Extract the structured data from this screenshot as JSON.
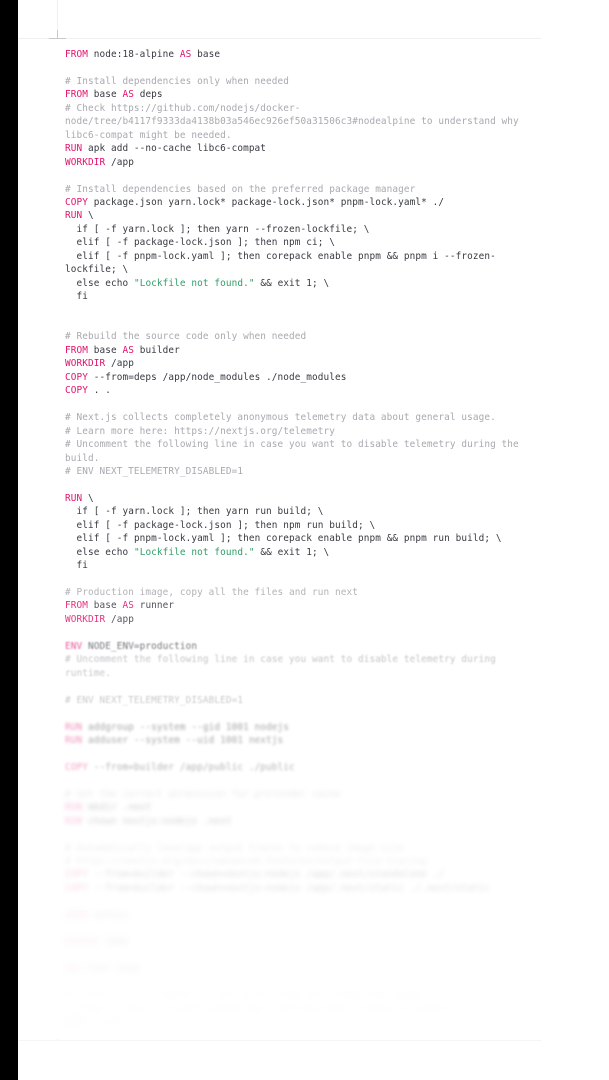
{
  "document": {
    "language": "dockerfile",
    "colors": {
      "keyword": "#e3116c",
      "plain": "#383a42",
      "comment": "#a9a9b0",
      "string": "#2f9e68",
      "background": "#ffffff",
      "guide_line": "#f0f0f2",
      "edge_strip": "#000000"
    }
  },
  "code": {
    "groups": [
      {
        "blur": 0,
        "lines": [
          [
            {
              "t": "kw",
              "v": "FROM"
            },
            {
              "t": "plain",
              "v": " node:18-alpine "
            },
            {
              "t": "kw",
              "v": "AS"
            },
            {
              "t": "plain",
              "v": " base"
            }
          ],
          [],
          [
            {
              "t": "comment",
              "v": "# Install dependencies only when needed"
            }
          ],
          [
            {
              "t": "kw",
              "v": "FROM"
            },
            {
              "t": "plain",
              "v": " base "
            },
            {
              "t": "kw",
              "v": "AS"
            },
            {
              "t": "plain",
              "v": " deps"
            }
          ],
          [
            {
              "t": "comment",
              "v": "# Check https://github.com/nodejs/docker-node/tree/b4117f9333da4138b03a546ec926ef50a31506c3#nodealpine to understand why libc6-compat might be needed."
            }
          ],
          [
            {
              "t": "kw",
              "v": "RUN"
            },
            {
              "t": "plain",
              "v": " apk add --no-cache libc6-compat"
            }
          ],
          [
            {
              "t": "kw",
              "v": "WORKDIR"
            },
            {
              "t": "plain",
              "v": " /app"
            }
          ],
          [],
          [
            {
              "t": "comment",
              "v": "# Install dependencies based on the preferred package manager"
            }
          ],
          [
            {
              "t": "kw",
              "v": "COPY"
            },
            {
              "t": "plain",
              "v": " package.json yarn.lock* package-lock.json* pnpm-lock.yaml* ./"
            }
          ],
          [
            {
              "t": "kw",
              "v": "RUN"
            },
            {
              "t": "plain",
              "v": " \\"
            }
          ],
          [
            {
              "t": "plain",
              "v": "  if [ -f yarn.lock ]; then yarn --frozen-lockfile; \\"
            }
          ],
          [
            {
              "t": "plain",
              "v": "  elif [ -f package-lock.json ]; then npm ci; \\"
            }
          ],
          [
            {
              "t": "plain",
              "v": "  elif [ -f pnpm-lock.yaml ]; then corepack enable pnpm && pnpm i --frozen-lockfile; \\"
            }
          ],
          [
            {
              "t": "plain",
              "v": "  else echo "
            },
            {
              "t": "str",
              "v": "\"Lockfile not found.\""
            },
            {
              "t": "plain",
              "v": " && exit 1; \\"
            }
          ],
          [
            {
              "t": "plain",
              "v": "  fi"
            }
          ],
          [],
          [],
          [
            {
              "t": "comment",
              "v": "# Rebuild the source code only when needed"
            }
          ],
          [
            {
              "t": "kw",
              "v": "FROM"
            },
            {
              "t": "plain",
              "v": " base "
            },
            {
              "t": "kw",
              "v": "AS"
            },
            {
              "t": "plain",
              "v": " builder"
            }
          ],
          [
            {
              "t": "kw",
              "v": "WORKDIR"
            },
            {
              "t": "plain",
              "v": " /app"
            }
          ],
          [
            {
              "t": "kw",
              "v": "COPY"
            },
            {
              "t": "plain",
              "v": " --from=deps /app/node_modules ./node_modules"
            }
          ],
          [
            {
              "t": "kw",
              "v": "COPY"
            },
            {
              "t": "plain",
              "v": " . ."
            }
          ],
          [],
          [
            {
              "t": "comment",
              "v": "# Next.js collects completely anonymous telemetry data about general usage."
            }
          ],
          [
            {
              "t": "comment",
              "v": "# Learn more here: https://nextjs.org/telemetry"
            }
          ],
          [
            {
              "t": "comment",
              "v": "# Uncomment the following line in case you want to disable telemetry during the build."
            }
          ],
          [
            {
              "t": "comment",
              "v": "# ENV NEXT_TELEMETRY_DISABLED=1"
            }
          ],
          [],
          [
            {
              "t": "kw",
              "v": "RUN"
            },
            {
              "t": "plain",
              "v": " \\"
            }
          ],
          [
            {
              "t": "plain",
              "v": "  if [ -f yarn.lock ]; then yarn run build; \\"
            }
          ],
          [
            {
              "t": "plain",
              "v": "  elif [ -f package-lock.json ]; then npm run build; \\"
            }
          ],
          [
            {
              "t": "plain",
              "v": "  elif [ -f pnpm-lock.yaml ]; then corepack enable pnpm && pnpm run build; \\"
            }
          ],
          [
            {
              "t": "plain",
              "v": "  else echo "
            },
            {
              "t": "str",
              "v": "\"Lockfile not found.\""
            },
            {
              "t": "plain",
              "v": " && exit 1; \\"
            }
          ],
          [
            {
              "t": "plain",
              "v": "  fi"
            }
          ],
          []
        ]
      },
      {
        "blur": 1,
        "lines": [
          [
            {
              "t": "comment",
              "v": "# Production image, copy all the files and run next"
            }
          ],
          [
            {
              "t": "kw",
              "v": "FROM"
            },
            {
              "t": "plain",
              "v": " base "
            },
            {
              "t": "kw",
              "v": "AS"
            },
            {
              "t": "plain",
              "v": " runner"
            }
          ],
          [
            {
              "t": "kw",
              "v": "WORKDIR"
            },
            {
              "t": "plain",
              "v": " /app"
            }
          ],
          []
        ]
      },
      {
        "blur": 2,
        "lines": [
          [
            {
              "t": "kw",
              "v": "ENV"
            },
            {
              "t": "plain",
              "v": " NODE_ENV=production"
            }
          ],
          [
            {
              "t": "comment",
              "v": "# Uncomment the following line in case you want to disable telemetry during runtime."
            }
          ],
          [],
          [
            {
              "t": "comment",
              "v": "# ENV NEXT_TELEMETRY_DISABLED=1"
            }
          ],
          []
        ]
      },
      {
        "blur": 3,
        "lines": [
          [
            {
              "t": "kw",
              "v": "RUN"
            },
            {
              "t": "plain",
              "v": " addgroup --system --gid 1001 nodejs"
            }
          ],
          [
            {
              "t": "kw",
              "v": "RUN"
            },
            {
              "t": "plain",
              "v": " adduser --system --uid 1001 nextjs"
            }
          ],
          [],
          [
            {
              "t": "kw",
              "v": "COPY"
            },
            {
              "t": "plain",
              "v": " --from=builder /app/public ./public"
            }
          ],
          []
        ]
      },
      {
        "blur": 4,
        "lines": [
          [
            {
              "t": "comment",
              "v": "# Set the correct permission for prerender cache"
            }
          ],
          [
            {
              "t": "kw",
              "v": "RUN"
            },
            {
              "t": "plain",
              "v": " mkdir .next"
            }
          ],
          [
            {
              "t": "kw",
              "v": "RUN"
            },
            {
              "t": "plain",
              "v": " chown nextjs:nodejs .next"
            }
          ],
          [],
          [
            {
              "t": "comment",
              "v": "# Automatically leverage output traces to reduce image size"
            }
          ],
          [
            {
              "t": "comment",
              "v": "# https://nextjs.org/docs/advanced-features/output-file-tracing"
            }
          ],
          [
            {
              "t": "kw",
              "v": "COPY"
            },
            {
              "t": "plain",
              "v": " --from=builder --chown=nextjs:nodejs /app/.next/standalone ./"
            }
          ],
          [
            {
              "t": "kw",
              "v": "COPY"
            },
            {
              "t": "plain",
              "v": " --from=builder --chown=nextjs:nodejs /app/.next/static ./.next/static"
            }
          ],
          []
        ]
      },
      {
        "blur": 5,
        "lines": [
          [
            {
              "t": "kw",
              "v": "USER"
            },
            {
              "t": "plain",
              "v": " nextjs"
            }
          ],
          [],
          [
            {
              "t": "kw",
              "v": "EXPOSE"
            },
            {
              "t": "plain",
              "v": " 3000"
            }
          ],
          [],
          [
            {
              "t": "kw",
              "v": "ENV"
            },
            {
              "t": "plain",
              "v": " PORT 3000"
            }
          ],
          []
        ]
      },
      {
        "blur": 6,
        "lines": [
          [
            {
              "t": "comment",
              "v": "# server.js is created by next build from the standalone output"
            }
          ],
          [
            {
              "t": "comment",
              "v": "# https://nextjs.org/docs/pages/api-reference/next-config-js/output"
            }
          ],
          [
            {
              "t": "kw",
              "v": "CMD"
            },
            {
              "t": "plain",
              "v": " ["
            },
            {
              "t": "str",
              "v": "\"node\""
            },
            {
              "t": "plain",
              "v": ", "
            },
            {
              "t": "str",
              "v": "\"server.js\""
            },
            {
              "t": "plain",
              "v": "]"
            }
          ]
        ]
      }
    ]
  }
}
